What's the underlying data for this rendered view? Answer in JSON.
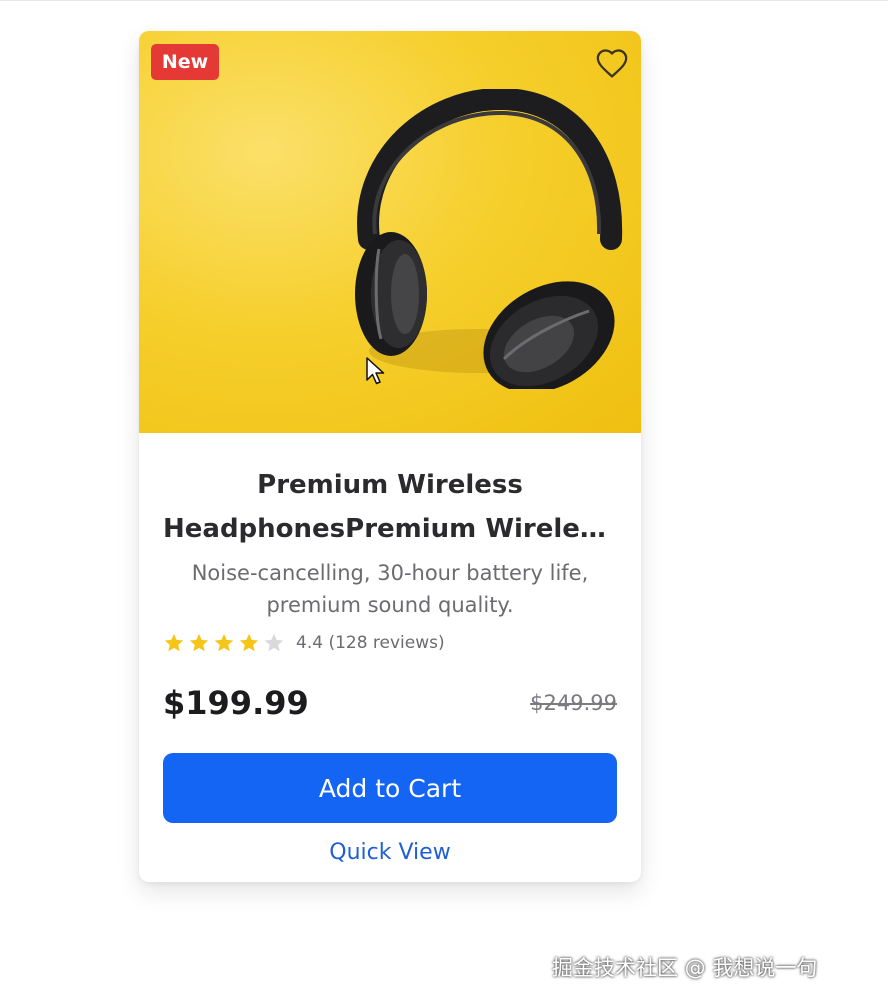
{
  "product": {
    "badge": "New",
    "title_line1": "Premium Wireless",
    "title_line2": "HeadphonesPremium Wireles...",
    "description": "Noise-cancelling, 30-hour battery life, premium sound quality.",
    "rating": {
      "value": 4.4,
      "max": 5,
      "stars_filled": 4,
      "text": "4.4 (128 reviews)"
    },
    "price": "$199.99",
    "original_price": "$249.99",
    "add_to_cart_label": "Add to Cart",
    "quick_view_label": "Quick View",
    "image_icon": "headphones-image",
    "wishlist_icon": "heart-outline-icon"
  },
  "colors": {
    "image_background": "#f6cf2c",
    "badge_background": "#e53935",
    "button_primary": "#1565f5",
    "link": "#1f5fd6",
    "star_filled": "#f5c518",
    "star_empty": "#d9d9dc"
  },
  "watermark": "掘金技术社区 @ 我想说一句"
}
